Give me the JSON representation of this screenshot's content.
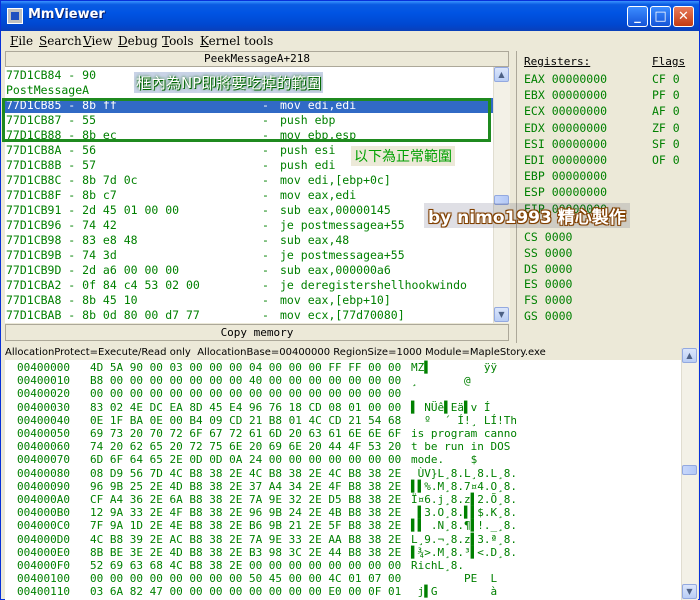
{
  "window": {
    "title": "MmViewer",
    "min_label": "_",
    "max_label": "□",
    "close_label": "✕"
  },
  "menu": [
    "File",
    "Search",
    "View",
    "Debug",
    "Tools",
    "Kernel tools"
  ],
  "disasm": {
    "header": "PeekMessageA+218",
    "rows": [
      {
        "addr": "77D1CB84 - 90",
        "sep": "",
        "instr": ""
      },
      {
        "addr": "PostMessageA",
        "sep": "",
        "instr": ""
      },
      {
        "addr": "77D1CB85 - 8b ff",
        "sep": "-",
        "instr": "mov edi,edi",
        "selected": true
      },
      {
        "addr": "77D1CB87 - 55",
        "sep": "-",
        "instr": "push ebp"
      },
      {
        "addr": "77D1CB88 - 8b ec",
        "sep": "-",
        "instr": "mov ebp,esp"
      },
      {
        "addr": "77D1CB8A - 56",
        "sep": "-",
        "instr": "push esi"
      },
      {
        "addr": "77D1CB8B - 57",
        "sep": "-",
        "instr": "push edi"
      },
      {
        "addr": "77D1CB8C - 8b 7d 0c",
        "sep": "-",
        "instr": "mov edi,[ebp+0c]"
      },
      {
        "addr": "77D1CB8F - 8b c7",
        "sep": "-",
        "instr": "mov eax,edi"
      },
      {
        "addr": "77D1CB91 - 2d 45 01 00 00",
        "sep": "-",
        "instr": "sub eax,00000145"
      },
      {
        "addr": "77D1CB96 - 74 42",
        "sep": "-",
        "instr": "je postmessagea+55"
      },
      {
        "addr": "77D1CB98 - 83 e8 48",
        "sep": "-",
        "instr": "sub eax,48"
      },
      {
        "addr": "77D1CB9B - 74 3d",
        "sep": "-",
        "instr": "je postmessagea+55"
      },
      {
        "addr": "77D1CB9D - 2d a6 00 00 00",
        "sep": "-",
        "instr": "sub eax,000000a6"
      },
      {
        "addr": "77D1CBA2 - 0f 84 c4 53 02 00",
        "sep": "-",
        "instr": "je deregistershellhookwindo"
      },
      {
        "addr": "77D1CBA8 - 8b 45 10",
        "sep": "-",
        "instr": "mov eax,[ebp+10]"
      },
      {
        "addr": "77D1CBAB - 8b 0d 80 00 d7 77",
        "sep": "-",
        "instr": "mov ecx,[77d70080]"
      }
    ],
    "copy_memory": "Copy memory"
  },
  "registers": {
    "label": "Registers:",
    "flags_label": "Flags",
    "regs": [
      "EAX 00000000",
      "EBX 00000000",
      "ECX 00000000",
      "EDX 00000000",
      "ESI 00000000",
      "EDI 00000000",
      "EBP 00000000",
      "ESP 00000000",
      "EIP 00000000"
    ],
    "segs": [
      "CS 0000",
      "SS 0000",
      "DS 0000",
      "ES 0000",
      "FS 0000",
      "GS 0000"
    ],
    "flags": [
      "CF 0",
      "PF 0",
      "AF 0",
      "ZF 0",
      "SF 0",
      "OF 0"
    ]
  },
  "annotations": {
    "np_note": "框內為NP即將要吃掉的範圍",
    "normal_note": "以下為正常範圍",
    "brand": "by nimo1993 精心製作",
    "box_color": "#1f8a1f"
  },
  "dump": {
    "header": "AllocationProtect=Execute/Read only  AllocationBase=00400000 RegionSize=1000 Module=MapleStory.exe",
    "rows": [
      {
        "addr": "00400000",
        "bytes": "4D 5A 90 00 03 00 00 00 04 00 00 00 FF FF 00 00",
        "ascii": "MZ▌        ÿÿ"
      },
      {
        "addr": "00400010",
        "bytes": "B8 00 00 00 00 00 00 00 40 00 00 00 00 00 00 00",
        "ascii": "¸       @"
      },
      {
        "addr": "00400020",
        "bytes": "00 00 00 00 00 00 00 00 00 00 00 00 00 00 00 00",
        "ascii": ""
      },
      {
        "addr": "00400030",
        "bytes": "83 02 4E DC EA 8D 45 E4 96 76 18 CD 08 01 00 00",
        "ascii": "▌ NÜê▌Eä▌v Í"
      },
      {
        "addr": "00400040",
        "bytes": "0E 1F BA 0E 00 B4 09 CD 21 B8 01 4C CD 21 54 68",
        "ascii": "  º  ´ Í!¸ LÍ!Th"
      },
      {
        "addr": "00400050",
        "bytes": "69 73 20 70 72 6F 67 72 61 6D 20 63 61 6E 6E 6F",
        "ascii": "is program canno"
      },
      {
        "addr": "00400060",
        "bytes": "74 20 62 65 20 72 75 6E 20 69 6E 20 44 4F 53 20",
        "ascii": "t be run in DOS"
      },
      {
        "addr": "00400070",
        "bytes": "6D 6F 64 65 2E 0D 0D 0A 24 00 00 00 00 00 00 00",
        "ascii": "mode.    $"
      },
      {
        "addr": "00400080",
        "bytes": "08 D9 56 7D 4C B8 38 2E 4C B8 38 2E 4C B8 38 2E",
        "ascii": " ÙV}L¸8.L¸8.L¸8."
      },
      {
        "addr": "00400090",
        "bytes": "96 9B 25 2E 4D B8 38 2E 37 A4 34 2E 4F B8 38 2E",
        "ascii": "▌▌%.M¸8.7¤4.O¸8."
      },
      {
        "addr": "004000A0",
        "bytes": "CF A4 36 2E 6A B8 38 2E 7A 9E 32 2E D5 B8 38 2E",
        "ascii": "Ï¤6.j¸8.z▌2.Õ¸8."
      },
      {
        "addr": "004000B0",
        "bytes": "12 9A 33 2E 4F B8 38 2E 96 9B 24 2E 4B B8 38 2E",
        "ascii": " ▌3.O¸8.▌▌$.K¸8."
      },
      {
        "addr": "004000C0",
        "bytes": "7F 9A 1D 2E 4E B8 38 2E B6 9B 21 2E 5F B8 38 2E",
        "ascii": "▌▌ .N¸8.¶▌!._¸8."
      },
      {
        "addr": "004000D0",
        "bytes": "4C B8 39 2E AC B8 38 2E 7A 9E 33 2E AA B8 38 2E",
        "ascii": "L¸9.¬¸8.z▌3.ª¸8."
      },
      {
        "addr": "004000E0",
        "bytes": "8B BE 3E 2E 4D B8 38 2E B3 98 3C 2E 44 B8 38 2E",
        "ascii": "▌¾>.M¸8.³▌<.D¸8."
      },
      {
        "addr": "004000F0",
        "bytes": "52 69 63 68 4C B8 38 2E 00 00 00 00 00 00 00 00",
        "ascii": "RichL¸8."
      },
      {
        "addr": "00400100",
        "bytes": "00 00 00 00 00 00 00 00 50 45 00 00 4C 01 07 00",
        "ascii": "        PE  L"
      },
      {
        "addr": "00400110",
        "bytes": "03 6A 82 47 00 00 00 00 00 00 00 00 E0 00 0F 01",
        "ascii": " j▌G        à"
      }
    ]
  }
}
